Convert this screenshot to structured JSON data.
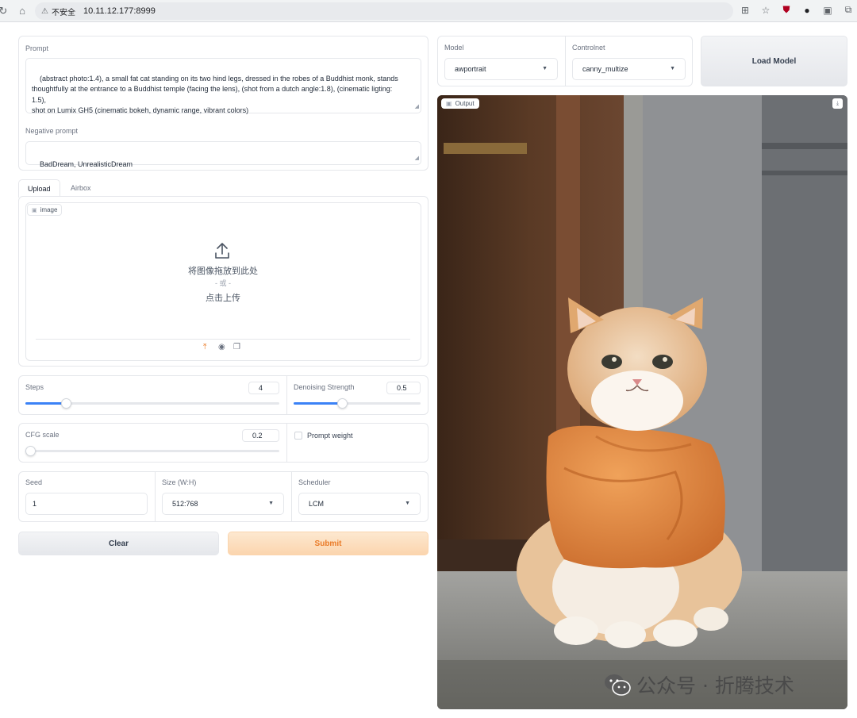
{
  "browser": {
    "security_label": "不安全",
    "url": "10.11.12.177:8999"
  },
  "prompt": {
    "label": "Prompt",
    "value": "(abstract photo:1.4), a small fat cat standing on its two hind legs, dressed in the robes of a Buddhist monk, stands\nthoughtfully at the entrance to a Buddhist temple (facing the lens), (shot from a dutch angle:1.8), (cinematic ligting:\n1.5),\nshot on Lumix GH5 (cinematic bokeh, dynamic range, vibrant colors)"
  },
  "negative_prompt": {
    "label": "Negative prompt",
    "value": "BadDream, UnrealisticDream"
  },
  "tabs": [
    {
      "label": "Upload",
      "active": true
    },
    {
      "label": "Airbox",
      "active": false
    }
  ],
  "upload": {
    "tag": "image",
    "drop_text": "将图像拖放到此处",
    "or_text": "- 或 -",
    "click_text": "点击上传"
  },
  "steps": {
    "label": "Steps",
    "value": 4,
    "fraction": 0.16
  },
  "denoising": {
    "label": "Denoising Strength",
    "value": 0.5,
    "fraction": 0.38
  },
  "cfg": {
    "label": "CFG scale",
    "value": 0.2,
    "fraction": 0.02
  },
  "prompt_weight": {
    "label": "Prompt weight",
    "checked": false
  },
  "seed": {
    "label": "Seed",
    "value": "1"
  },
  "size": {
    "label": "Size (W:H)",
    "value": "512:768"
  },
  "scheduler": {
    "label": "Scheduler",
    "value": "LCM"
  },
  "buttons": {
    "clear": "Clear",
    "submit": "Submit",
    "load_model": "Load Model"
  },
  "model": {
    "label": "Model",
    "value": "awportrait"
  },
  "controlnet": {
    "label": "Controlnet",
    "value": "canny_multize"
  },
  "output": {
    "tag": "Output"
  },
  "watermark": {
    "text": "公众号 · 折腾技术"
  },
  "colors": {
    "accent": "#3b82f6",
    "submit_text": "#ea7b28",
    "robe": "#e0843a"
  }
}
